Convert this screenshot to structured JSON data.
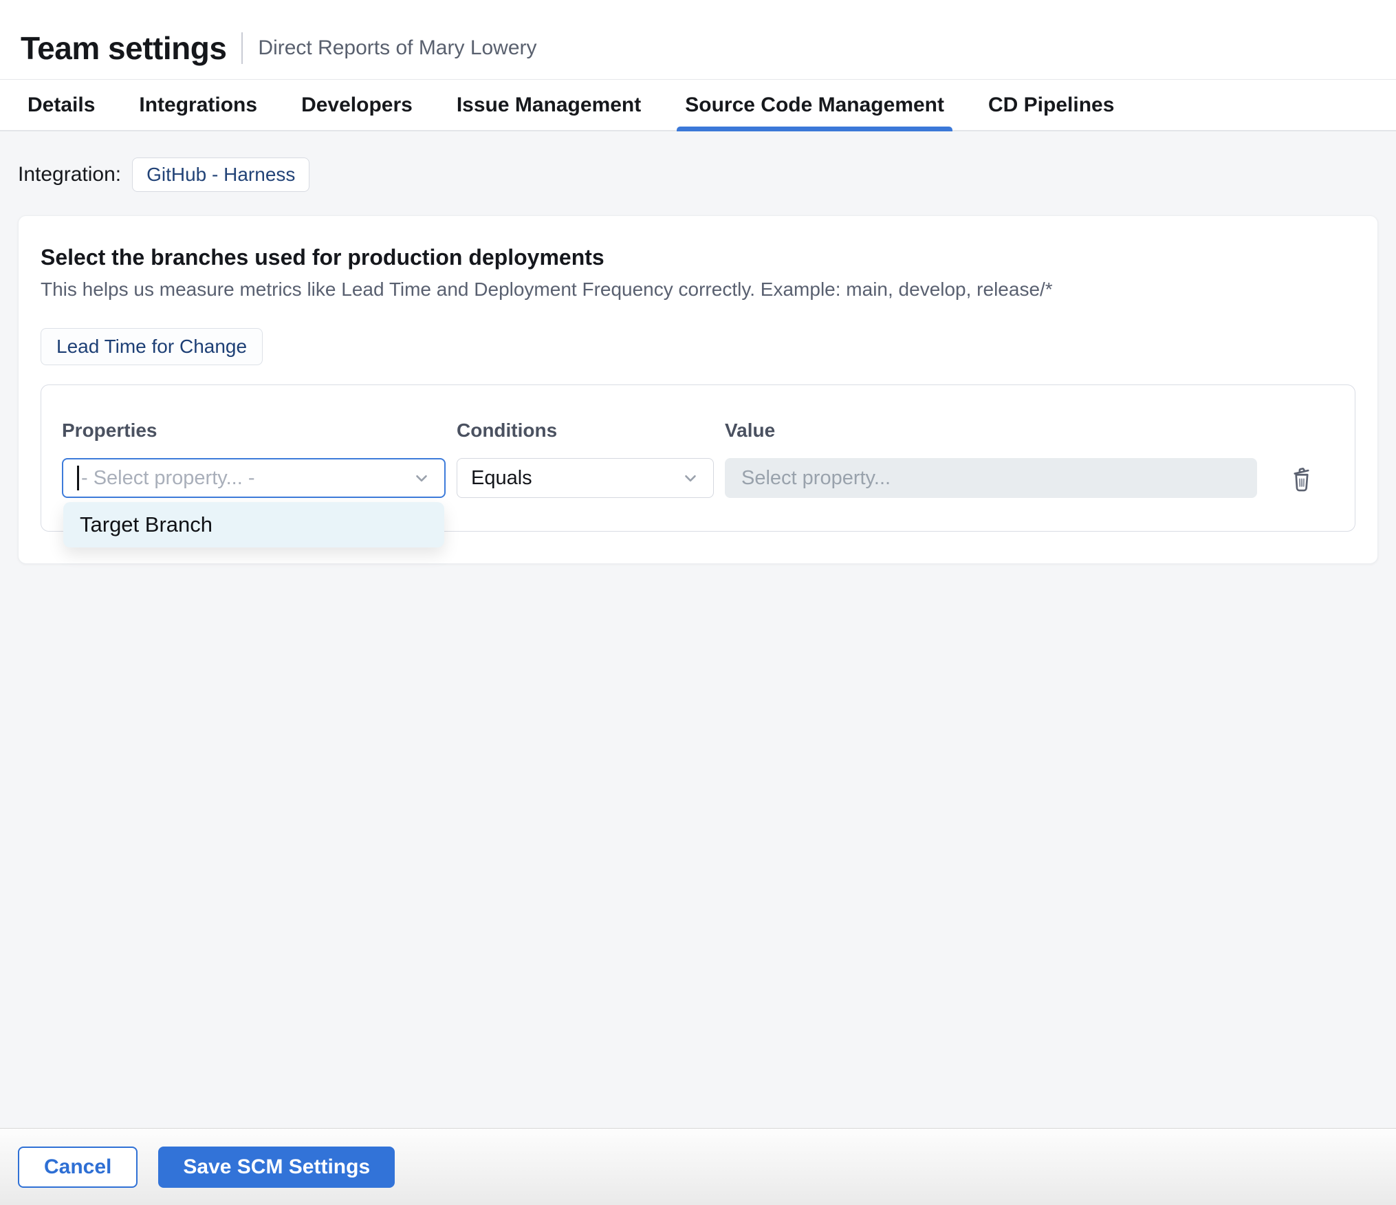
{
  "header": {
    "title": "Team settings",
    "subtitle": "Direct Reports of Mary Lowery"
  },
  "tabs": [
    {
      "label": "Details",
      "active": false
    },
    {
      "label": "Integrations",
      "active": false
    },
    {
      "label": "Developers",
      "active": false
    },
    {
      "label": "Issue Management",
      "active": false
    },
    {
      "label": "Source Code Management",
      "active": true
    },
    {
      "label": "CD Pipelines",
      "active": false
    }
  ],
  "integration": {
    "label": "Integration:",
    "chip": "GitHub - Harness"
  },
  "card": {
    "heading": "Select the branches used for production deployments",
    "description": "This helps us measure metrics like Lead Time and Deployment Frequency correctly. Example: main, develop, release/*",
    "metric_tag": "Lead Time for Change",
    "rule": {
      "properties_label": "Properties",
      "conditions_label": "Conditions",
      "value_label": "Value",
      "property_placeholder": "- Select property... -",
      "condition_value": "Equals",
      "value_placeholder": "Select property...",
      "dropdown_options": [
        "Target Branch"
      ],
      "icons": [
        "chevron-down-icon",
        "chevron-down-icon",
        "trash-icon"
      ]
    }
  },
  "footer": {
    "cancel_label": "Cancel",
    "save_label": "Save SCM Settings"
  },
  "colors": {
    "accent_blue": "#3b78d8",
    "chip_text_navy": "#1d3f75",
    "dropdown_highlight": "#e9f4f9",
    "value_field_bg": "#e8ecef",
    "focus_border": "#3d7bda"
  }
}
